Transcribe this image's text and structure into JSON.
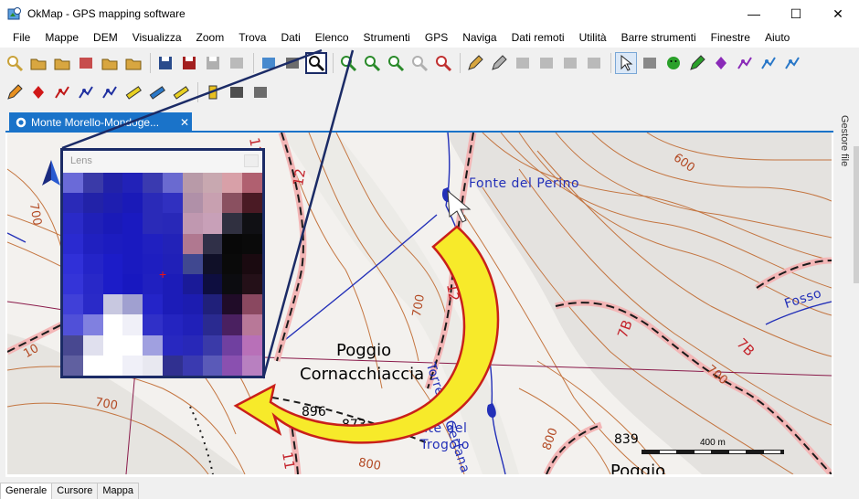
{
  "window": {
    "title": "OkMap - GPS mapping software",
    "minimize": "—",
    "maximize": "☐",
    "close": "✕"
  },
  "menu": [
    "File",
    "Mappe",
    "DEM",
    "Visualizza",
    "Zoom",
    "Trova",
    "Dati",
    "Elenco",
    "Strumenti",
    "GPS",
    "Naviga",
    "Dati remoti",
    "Utilità",
    "Barre strumenti",
    "Finestre",
    "Aiuto"
  ],
  "toolbar1": [
    {
      "name": "find-map-icon",
      "color": "#c9a23a"
    },
    {
      "name": "open-folder-map-icon",
      "color": "#d8a640"
    },
    {
      "name": "open-folder-settings-icon",
      "color": "#d8a640"
    },
    {
      "name": "map-tool-icon",
      "color": "#c03030"
    },
    {
      "name": "open-folder-red-icon",
      "color": "#d8a640"
    },
    {
      "name": "open-folder-icon",
      "color": "#d8a640"
    },
    {
      "sep": true
    },
    {
      "name": "save-icon",
      "color": "#2a4b8c"
    },
    {
      "name": "save-all-icon",
      "color": "#a32020"
    },
    {
      "name": "save-disabled-icon",
      "color": "#b0b0b0"
    },
    {
      "name": "export-disabled-icon",
      "color": "#b0b0b0"
    },
    {
      "sep": true
    },
    {
      "name": "pan-icon",
      "color": "#2a78c8"
    },
    {
      "name": "overview-icon",
      "color": "#555555"
    },
    {
      "name": "lens-icon",
      "color": "#111111",
      "focus": true
    },
    {
      "sep": true
    },
    {
      "name": "zoom-in-icon",
      "color": "#2a8a2a"
    },
    {
      "name": "zoom-out-icon",
      "color": "#2a8a2a"
    },
    {
      "name": "zoom-window-icon",
      "color": "#2a8a2a"
    },
    {
      "name": "zoom-scale-icon",
      "color": "#b0b0b0"
    },
    {
      "name": "zoom-1-1-icon",
      "color": "#c03030"
    },
    {
      "sep": true
    },
    {
      "name": "edit-icon",
      "color": "#d8a640"
    },
    {
      "name": "edit-disabled-icon",
      "color": "#b0b0b0"
    },
    {
      "name": "layer-disabled-icon",
      "color": "#b0b0b0"
    },
    {
      "name": "copy-disabled-icon",
      "color": "#b0b0b0"
    },
    {
      "name": "delete-disabled-icon",
      "color": "#b0b0b0"
    },
    {
      "name": "move-disabled-icon",
      "color": "#b0b0b0"
    },
    {
      "sep": true
    },
    {
      "name": "select-cursor-icon",
      "color": "#222222",
      "pressed": true
    },
    {
      "name": "measure-icon",
      "color": "#777777"
    },
    {
      "name": "smiley-icon",
      "color": "#2aa02a"
    },
    {
      "name": "draw-green-icon",
      "color": "#2aa02a"
    },
    {
      "name": "waypoints-icon",
      "color": "#8a2ab8"
    },
    {
      "name": "route-icon",
      "color": "#8a2ab8"
    },
    {
      "name": "track-icon",
      "color": "#2a78c8"
    },
    {
      "name": "track-edit-icon",
      "color": "#2a78c8"
    }
  ],
  "toolbar2": [
    {
      "name": "pencil-orange-icon",
      "color": "#e89020"
    },
    {
      "name": "waypoint-red-icon",
      "color": "#d01818"
    },
    {
      "name": "route-red-icon",
      "color": "#c01818"
    },
    {
      "name": "route-blue-icon",
      "color": "#2030a0"
    },
    {
      "name": "route-edit-icon",
      "color": "#2030a0"
    },
    {
      "name": "ruler-yellow-icon",
      "color": "#e8d020"
    },
    {
      "name": "ruler-blue-yellow-icon",
      "color": "#2a78c8"
    },
    {
      "name": "ruler-yellow-2-icon",
      "color": "#e8d020"
    },
    {
      "sep": true
    },
    {
      "name": "battery-icon",
      "color": "#e8c020"
    },
    {
      "name": "gps-pointer-icon",
      "color": "#333333"
    },
    {
      "name": "properties-icon",
      "color": "#555555"
    }
  ],
  "document": {
    "tab_label": "Monte Morello-Mondoge...",
    "tab_close": "✕"
  },
  "map": {
    "labels": {
      "fonte_perino": "Fonte del Perino",
      "fonte_trogolo_1": "Fonte del",
      "fonte_trogolo_2": "Trogolo",
      "torrente": "Torrente Gerfana",
      "fosso": "Fosso",
      "poggio_1": "Poggio",
      "poggio_2": "Cornacchiaccia",
      "poggio_br": "Poggio",
      "spot_896": "896",
      "spot_873": "873",
      "spot_839": "839",
      "c_600": "600",
      "c_700a": "700",
      "c_700b": "700",
      "c_700c": "700",
      "c_700d": "700",
      "c_800a": "800",
      "c_800b": "800",
      "c_10": "10",
      "trail_12a": "12",
      "trail_12b": "12",
      "trail_7b_a": "7B",
      "trail_7b_b": "7B",
      "trail_11a": "11",
      "trail_11b": "11"
    },
    "scale_label": "400 m",
    "colors": {
      "contour": "#c0692f",
      "trail": "#c4232b",
      "water": "#2330b8",
      "road": "#1a1a1a",
      "border": "#8a1a4a"
    }
  },
  "lens": {
    "title": "Lens",
    "crosshair": "+",
    "pixels": [
      [
        "#6a6ad8",
        "#3a3aa8",
        "#2222a8",
        "#2222b8",
        "#3a3ab0",
        "#6a6ad0",
        "#b89aa8",
        "#c8a8b0",
        "#d8a0a8",
        "#b06070"
      ],
      [
        "#2a2ab8",
        "#2222a8",
        "#1e1eb0",
        "#1a1ab8",
        "#2a2ab8",
        "#3030c0",
        "#b090a8",
        "#c8a0b0",
        "#8a5060",
        "#4a1a24"
      ],
      [
        "#2a2ac8",
        "#2020b8",
        "#1a1ab8",
        "#1a1ac0",
        "#2a2ab8",
        "#2828b8",
        "#c098b0",
        "#c8a0b8",
        "#303040",
        "#101014"
      ],
      [
        "#2a2ad0",
        "#2020c0",
        "#1c1cc0",
        "#1a1ac0",
        "#2020c0",
        "#2222b8",
        "#b07890",
        "#303048",
        "#080808",
        "#0a0a0a"
      ],
      [
        "#3030d8",
        "#2424c8",
        "#1c1cc8",
        "#1a1ac0",
        "#1e1ec0",
        "#2020b8",
        "#404890",
        "#101028",
        "#0a0a0a",
        "#1a0a10"
      ],
      [
        "#3434d8",
        "#2828c8",
        "#1c1cc8",
        "#1818c0",
        "#2020c0",
        "#1c1cb8",
        "#1a1a98",
        "#0e0e40",
        "#0c0c10",
        "#241018"
      ],
      [
        "#4040d8",
        "#2a2ac8",
        "#c8c8e0",
        "#a0a0d0",
        "#2424c8",
        "#1c1cb8",
        "#1c1cb0",
        "#20207a",
        "#200c28",
        "#8a4860"
      ],
      [
        "#5050d8",
        "#8080e0",
        "#ffffff",
        "#f0f0f8",
        "#3030c8",
        "#2424c0",
        "#2020b8",
        "#2a2a90",
        "#4a2060",
        "#b87898"
      ],
      [
        "#484890",
        "#e0e0ee",
        "#ffffff",
        "#ffffff",
        "#a0a0e0",
        "#2828c0",
        "#2828b8",
        "#3a3aa8",
        "#7040a0",
        "#b870b8"
      ],
      [
        "#6060a0",
        "#ffffff",
        "#ffffff",
        "#f0f0f8",
        "#e8e8f0",
        "#303090",
        "#3a3ab0",
        "#5a5ab8",
        "#8a50b0",
        "#b880c0"
      ]
    ]
  },
  "right_panel": {
    "label": "Gestore file"
  },
  "bottom_tabs": [
    "Generale",
    "Cursore",
    "Mappa"
  ]
}
